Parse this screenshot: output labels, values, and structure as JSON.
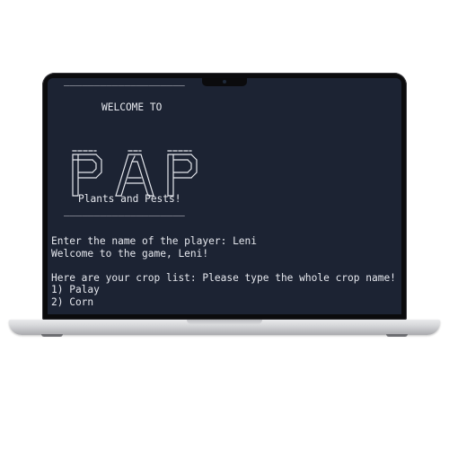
{
  "terminal": {
    "rule_top": "____________________",
    "welcome": "WELCOME TO",
    "banner_word": "PAP",
    "subtitle": "Plants and Pests!",
    "rule_bottom": "____________________",
    "prompt_name": "Enter the name of the player: Leni",
    "welcome_user": "Welcome to the game, Leni!",
    "crop_list_header": "Here are your crop list: Please type the whole crop name!",
    "crop_items": [
      "1) Palay",
      "2) Corn"
    ]
  },
  "colors": {
    "screen_bg": "#1c2333",
    "text": "#e6e8ee",
    "bezel": "#0b0b0d"
  }
}
